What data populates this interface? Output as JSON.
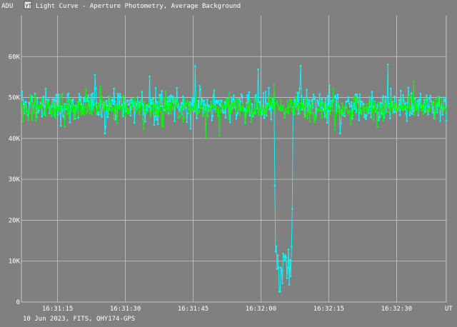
{
  "window": {
    "title": "Light Curve - Aperture Photometry, Average Background",
    "app_icon": "light-curve-app-icon"
  },
  "colors": {
    "background": "#808080",
    "grid": "#c8c8c8",
    "text": "#ffffff",
    "series_target": "#00ffff",
    "series_comparison": "#00ff00"
  },
  "footer": {
    "info": "10 Jun 2023, FITS, QHY174-GPS"
  },
  "chart_data": {
    "type": "line",
    "title": "Light Curve - Aperture Photometry, Average Background",
    "xlabel": "UT",
    "ylabel": "ADU",
    "ylim": [
      0,
      70000
    ],
    "xlim_seconds_of_day": [
      59467,
      59561
    ],
    "x_tick_labels": [
      "16:31:15",
      "16:31:30",
      "16:31:45",
      "16:32:00",
      "16:32:15",
      "16:32:30",
      "16:32:45"
    ],
    "x_tick_seconds_of_day": [
      59475,
      59490,
      59505,
      59520,
      59535,
      59550,
      59565
    ],
    "y_tick_labels": [
      "0",
      "10K",
      "20K",
      "30K",
      "40K",
      "50K",
      "60K"
    ],
    "y_tick_values": [
      0,
      10000,
      20000,
      30000,
      40000,
      50000,
      60000
    ],
    "grid": true,
    "series": [
      {
        "color": "#00ffff",
        "baseline": 48000,
        "scatter": 3800,
        "min_observed": 35500,
        "max_observed": 62000,
        "event": {
          "type": "occultation",
          "start": "16:32:03",
          "end": "16:32:07",
          "level_min": 0,
          "level_max": 15000,
          "ingress_value": 28500,
          "egress_value": 22800
        }
      },
      {
        "color": "#00ff00",
        "baseline": 47500,
        "scatter": 2600,
        "min_observed": 38000,
        "max_observed": 57000
      }
    ]
  }
}
